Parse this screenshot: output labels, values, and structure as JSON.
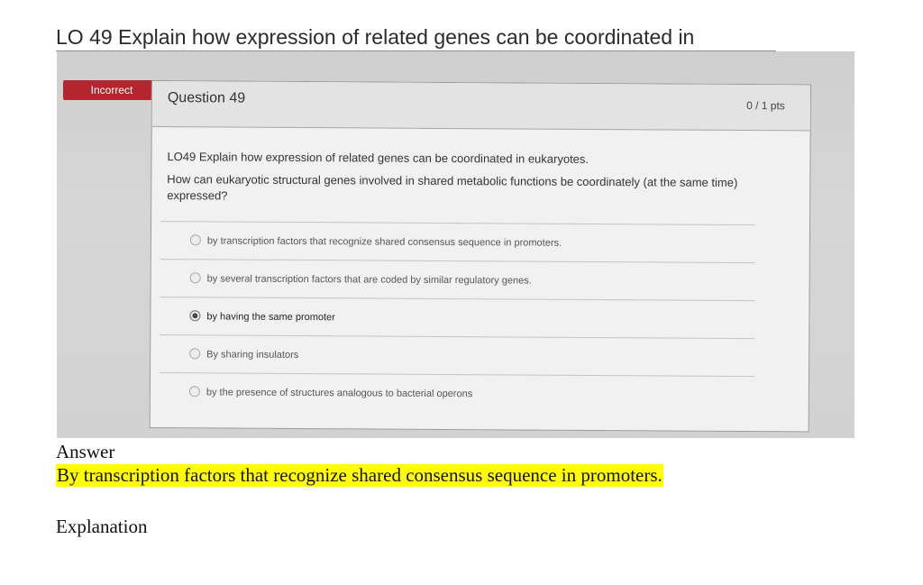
{
  "doc_title": "LO 49 Explain how expression of related genes can be coordinated in",
  "quiz": {
    "status_badge": "Incorrect",
    "question_title": "Question 49",
    "points": "0 / 1 pts",
    "learning_objective": "LO49 Explain how expression of related genes can be coordinated in eukaryotes.",
    "question_text": "How can eukaryotic structural genes involved in shared metabolic functions be coordinately (at the same time) expressed?",
    "answers": [
      {
        "label": "by transcription factors that recognize shared consensus sequence in promoters.",
        "selected": false
      },
      {
        "label": "by several transcription factors that are coded by similar regulatory genes.",
        "selected": false
      },
      {
        "label": "by having the same promoter",
        "selected": true
      },
      {
        "label": "By sharing insulators",
        "selected": false
      },
      {
        "label": "by the presence of structures analogous to bacterial operons",
        "selected": false
      }
    ]
  },
  "answer_section": {
    "heading": "Answer",
    "text": "By transcription factors that recognize shared consensus sequence in promoters."
  },
  "explanation_section": {
    "heading": "Explanation"
  },
  "colors": {
    "badge": "#b3262f",
    "highlight": "#ffff00"
  }
}
